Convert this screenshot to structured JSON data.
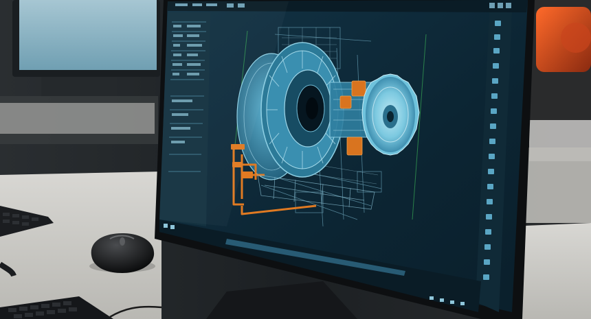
{
  "scene": {
    "subject": "cad-workstation-monitor",
    "colors": {
      "screen": "#0f2a3a",
      "model": "#6fc2dc",
      "accent": "#e07a22",
      "desk": "#c9c8c3",
      "bezel": "#0d0f11",
      "sidebar": "#143240"
    },
    "icons": [
      "computer-mouse-icon",
      "keyboard-icon",
      "cad-model-icon",
      "toolbar-icon"
    ]
  }
}
